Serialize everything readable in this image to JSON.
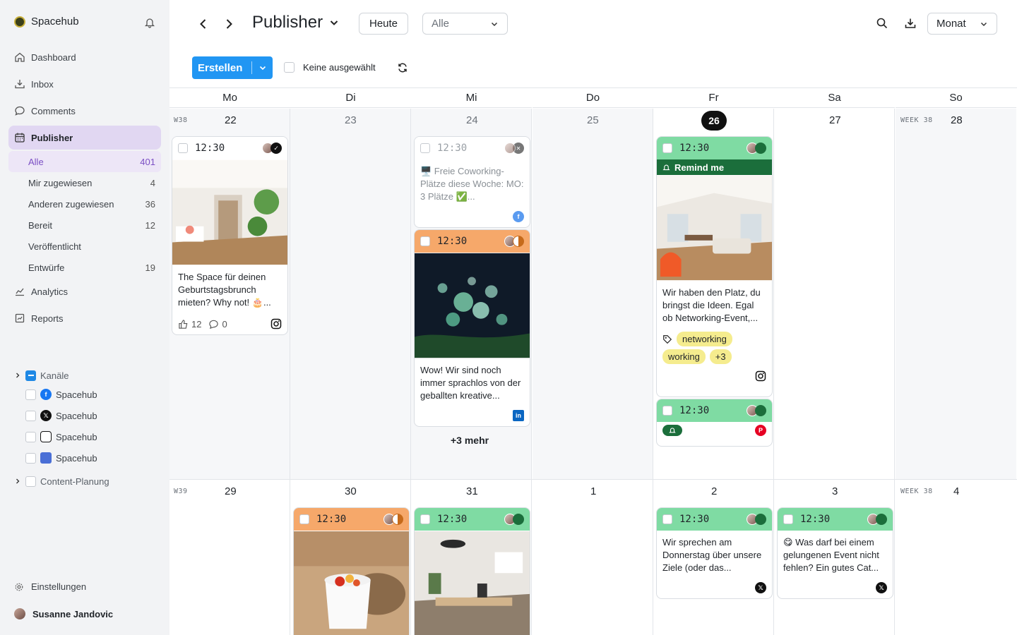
{
  "app": {
    "name": "Spacehub"
  },
  "nav": {
    "dashboard": "Dashboard",
    "inbox": "Inbox",
    "comments": "Comments",
    "publisher": "Publisher",
    "analytics": "Analytics",
    "reports": "Reports"
  },
  "publisher_sub": [
    {
      "label": "Alle",
      "count": "401"
    },
    {
      "label": "Mir zugewiesen",
      "count": "4"
    },
    {
      "label": "Anderen zugewiesen",
      "count": "36"
    },
    {
      "label": "Bereit",
      "count": "12"
    },
    {
      "label": "Veröffentlicht",
      "count": ""
    },
    {
      "label": "Entwürfe",
      "count": "19"
    }
  ],
  "channels": {
    "header": "Kanäle",
    "items": [
      "Spacehub",
      "Spacehub",
      "Spacehub",
      "Spacehub"
    ],
    "content_planning": "Content-Planung"
  },
  "settings_label": "Einstellungen",
  "user_name": "Susanne Jandovic",
  "topbar": {
    "title": "Publisher",
    "today_label": "Heute",
    "filter_value": "Alle",
    "view_value": "Monat",
    "create_label": "Erstellen",
    "none_selected": "Keine ausgewählt"
  },
  "weekdays": [
    "Mo",
    "Di",
    "Mi",
    "Do",
    "Fr",
    "Sa",
    "So"
  ],
  "week1": {
    "label": "W38",
    "sunday_label": "WEEK 38",
    "dates": [
      "22",
      "23",
      "24",
      "25",
      "26",
      "27",
      "28"
    ],
    "today": "26"
  },
  "week2": {
    "label": "W39",
    "sunday_label": "WEEK 38",
    "dates": [
      "29",
      "30",
      "31",
      "1",
      "2",
      "3",
      "4"
    ]
  },
  "posts": {
    "mo22": {
      "time": "12:30",
      "text": "The Space für deinen Geburtstagsbrunch mieten? Why not! 🎂...",
      "likes": "12",
      "comments": "0",
      "network": "instagram"
    },
    "mi24a": {
      "time": "12:30",
      "text": "🖥️ Freie Coworking-Plätze diese Woche: MO: 3 Plätze ✅...",
      "network": "facebook"
    },
    "mi24b": {
      "time": "12:30",
      "text": "Wow! Wir sind noch immer sprachlos von der geballten kreative...",
      "network": "linkedin"
    },
    "mi24_more": "+3 mehr",
    "fr26a": {
      "time": "12:30",
      "remind": "Remind me",
      "text": "Wir haben den Platz, du bringst die Ideen. Egal ob Networking-Event,...",
      "tags": [
        "networking",
        "working",
        "+3"
      ],
      "network": "instagram"
    },
    "fr26b": {
      "time": "12:30",
      "network": "pinterest"
    },
    "di30": {
      "time": "12:30"
    },
    "mi31": {
      "time": "12:30"
    },
    "fr2": {
      "time": "12:30",
      "text": "Wir sprechen am Donnerstag über unsere Ziele (oder das...",
      "network": "x"
    },
    "sa3": {
      "time": "12:30",
      "text": "😋 Was darf bei einem gelungenen Event nicht fehlen? Ein gutes Cat...",
      "network": "x"
    }
  },
  "colors": {
    "accent": "#2196f3",
    "publisher_active": "#e1d7f2",
    "status_green": "#7fdba3",
    "status_orange": "#f6a86a",
    "remind_bg": "#1b6e3b",
    "tag_bg": "#f5ec8e"
  }
}
